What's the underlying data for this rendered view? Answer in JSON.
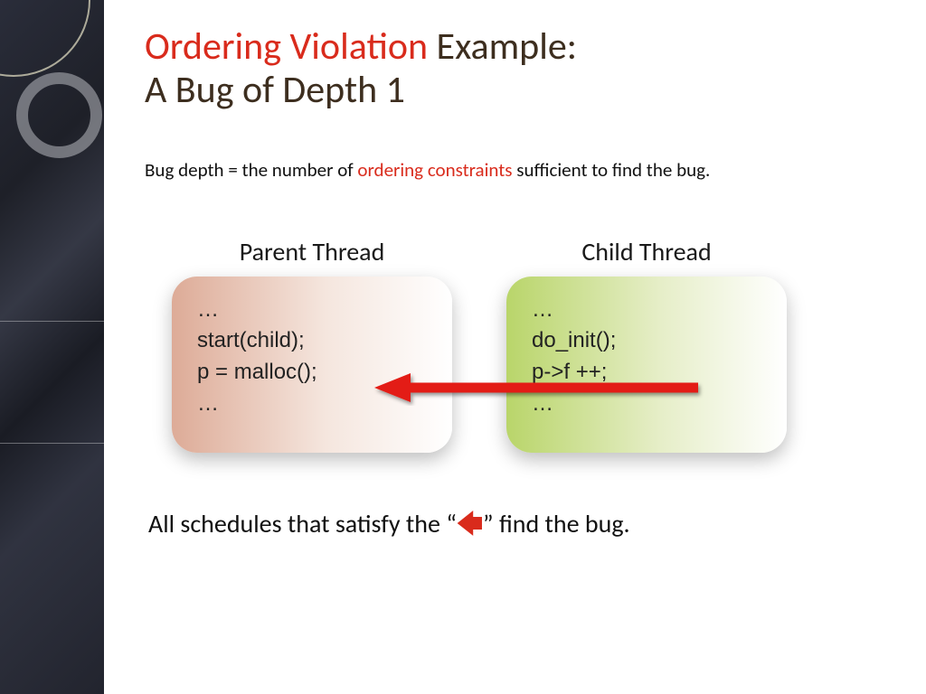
{
  "title": {
    "accent": "Ordering Violation",
    "rest1": " Example:",
    "line2": "A Bug of Depth 1"
  },
  "definition": {
    "pre": "Bug depth = the number of ",
    "accent": "ordering constraints",
    "post": " sufficient to find the bug."
  },
  "threads": {
    "parent": {
      "label": "Parent Thread",
      "code": [
        "…",
        "start(child);",
        "p = malloc();",
        "…"
      ]
    },
    "child": {
      "label": "Child Thread",
      "code": [
        "…",
        "do_init();",
        "p->f ++;",
        "…"
      ]
    }
  },
  "conclusion": {
    "pre": "All schedules that satisfy the “",
    "arrow": "←",
    "post": "” find the bug."
  }
}
